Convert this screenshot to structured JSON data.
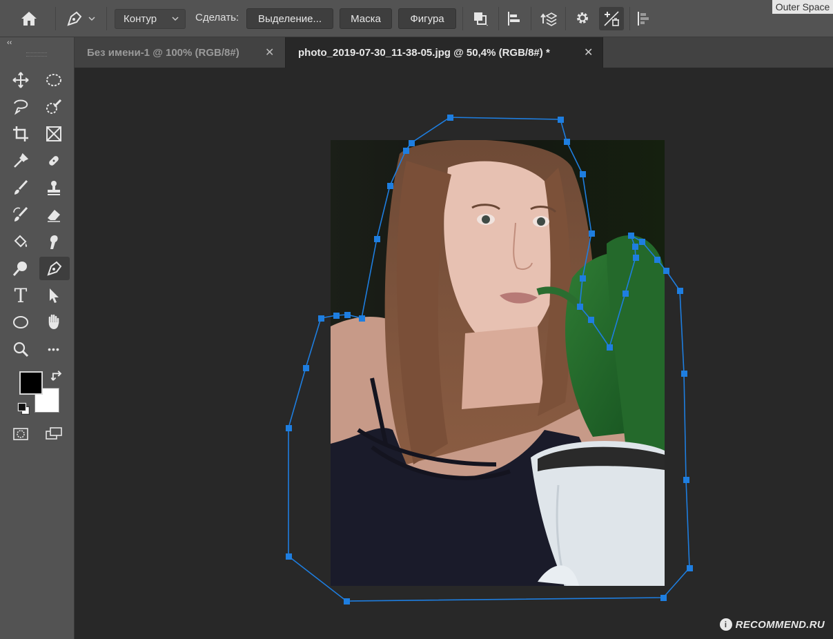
{
  "options_bar": {
    "home_icon": "home-icon",
    "tool_icon": "pen-tool-icon",
    "mode_dropdown": {
      "value": "Контур"
    },
    "make_label": "Сделать:",
    "buttons": {
      "selection": "Выделение...",
      "mask": "Маска",
      "shape": "Фигура"
    },
    "icons": [
      "path-operations-icon",
      "path-alignment-icon",
      "path-arrangement-icon",
      "gear-icon",
      "auto-add-delete-icon",
      "align-edges-icon"
    ]
  },
  "workspace": {
    "name": "Outer Space"
  },
  "toolbar": {
    "collapse_glyph": "‹‹",
    "tools": [
      "move-tool-icon",
      "elliptical-marquee-icon",
      "lasso-tool-icon",
      "quick-selection-icon",
      "crop-tool-icon",
      "frame-tool-icon",
      "eyedropper-icon",
      "spot-healing-icon",
      "brush-tool-icon",
      "clone-stamp-icon",
      "history-brush-icon",
      "eraser-icon",
      "paint-bucket-icon",
      "smudge-tool-icon",
      "dodge-tool-icon",
      "pen-tool-icon",
      "type-tool-icon",
      "path-selection-icon",
      "ellipse-tool-icon",
      "hand-tool-icon",
      "zoom-tool-icon",
      "more-tools-icon"
    ],
    "text_tool_glyph": "T",
    "more_glyph": "•••",
    "foreground_color": "#000000",
    "background_color": "#ffffff"
  },
  "tabs": [
    {
      "label": "Без имени-1 @ 100% (RGB/8#)",
      "active": false
    },
    {
      "label": "photo_2019-07-30_11-38-05.jpg @ 50,4% (RGB/8#) *",
      "active": true
    }
  ],
  "tab_close_glyph": "✕",
  "colors": {
    "path_stroke": "#1e7ee0",
    "anchor_fill": "#1e7ee0",
    "ui_panel": "#535353",
    "canvas_bg": "#282828"
  },
  "watermark": {
    "badge": "i",
    "text": "RECOMMEND.RU"
  }
}
